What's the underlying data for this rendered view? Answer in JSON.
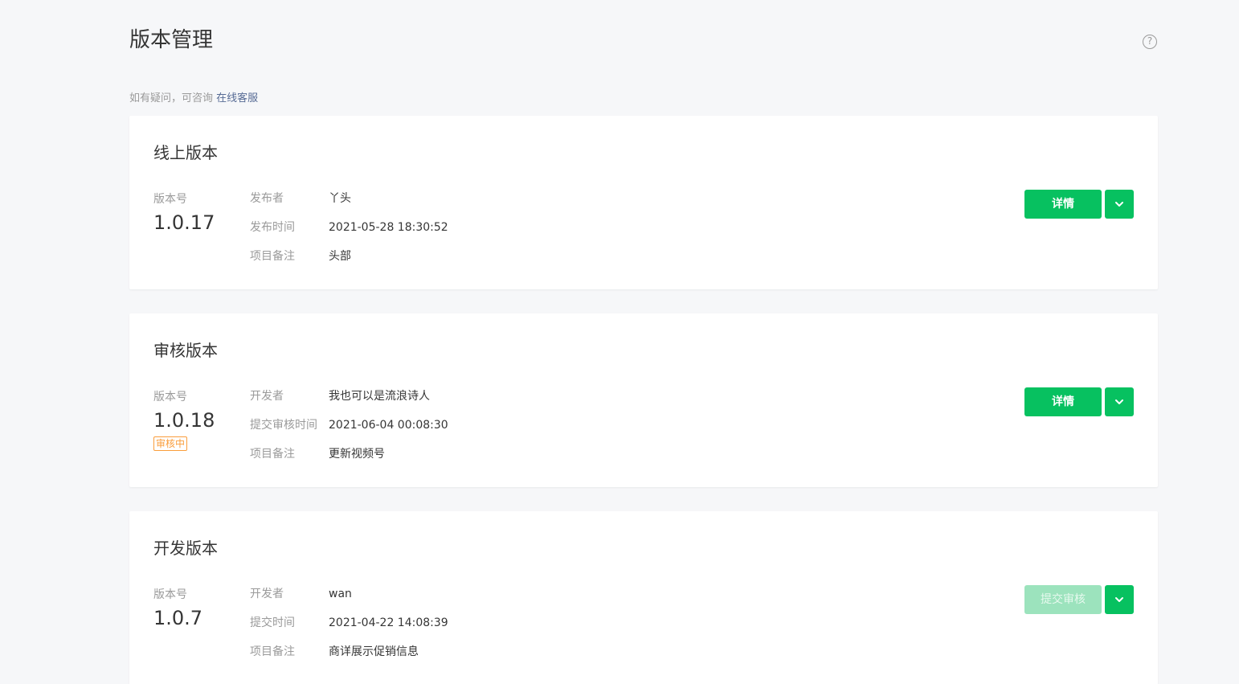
{
  "header": {
    "title": "版本管理",
    "help_icon": "?",
    "tip_text": "如有疑问，可咨询",
    "tip_link": "在线客服"
  },
  "colors": {
    "primary": "#07c160",
    "primary_disabled": "#9ce3bd",
    "badge": "#fa9d3b",
    "link": "#576b95"
  },
  "cards": [
    {
      "title": "线上版本",
      "version_label": "版本号",
      "version": "1.0.17",
      "rows": [
        {
          "label": "发布者",
          "value": "丫头"
        },
        {
          "label": "发布时间",
          "value": "2021-05-28 18:30:52"
        },
        {
          "label": "项目备注",
          "value": "头部"
        }
      ],
      "button": "详情"
    },
    {
      "title": "审核版本",
      "version_label": "版本号",
      "version": "1.0.18",
      "badge": "审核中",
      "rows": [
        {
          "label": "开发者",
          "value": "我也可以是流浪诗人"
        },
        {
          "label": "提交审核时间",
          "value": "2021-06-04 00:08:30"
        },
        {
          "label": "项目备注",
          "value": "更新视频号"
        }
      ],
      "button": "详情"
    },
    {
      "title": "开发版本",
      "version_label": "版本号",
      "version": "1.0.7",
      "rows": [
        {
          "label": "开发者",
          "value": "wan"
        },
        {
          "label": "提交时间",
          "value": "2021-04-22 14:08:39"
        },
        {
          "label": "项目备注",
          "value": "商详展示促销信息"
        }
      ],
      "button": "提交审核"
    }
  ]
}
